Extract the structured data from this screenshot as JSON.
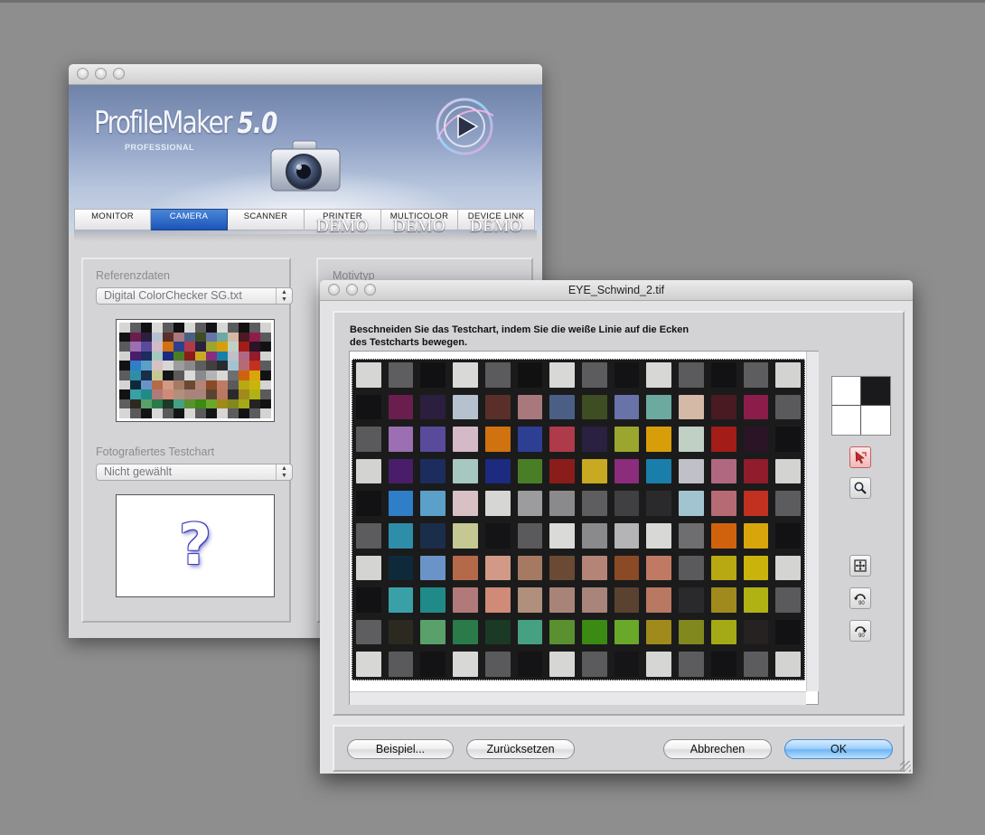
{
  "main_window": {
    "logo": {
      "name": "ProfileMaker",
      "version": "5.0",
      "subtitle": "PROFESSIONAL"
    },
    "tabs": [
      {
        "label": "MONITOR",
        "demo": "",
        "active": false
      },
      {
        "label": "CAMERA",
        "demo": "",
        "active": true
      },
      {
        "label": "SCANNER",
        "demo": "",
        "active": false
      },
      {
        "label": "PRINTER",
        "demo": "DEMO",
        "active": false
      },
      {
        "label": "MULTICOLOR",
        "demo": "DEMO",
        "active": false
      },
      {
        "label": "DEVICE LINK",
        "demo": "DEMO",
        "active": false
      }
    ],
    "reference": {
      "label": "Referenzdaten",
      "selected": "Digital ColorChecker SG.txt"
    },
    "photographed": {
      "label": "Fotografiertes Testchart",
      "selected": "Nicht gewählt",
      "placeholder_glyph": "?"
    },
    "motivtyp_label": "Motivtyp"
  },
  "crop_window": {
    "title": "EYE_Schwind_2.tif",
    "instruction": "Beschneiden Sie das Testchart, indem Sie die weiße Linie auf die Ecken des Testcharts bewegen.",
    "tools": [
      "crop-pointer-icon",
      "zoom-icon",
      "fit-icon",
      "rotate-left-90-icon",
      "rotate-right-90-icon"
    ],
    "rotate_label": "90",
    "buttons": {
      "example": "Beispiel...",
      "reset": "Zurücksetzen",
      "cancel": "Abbrechen",
      "ok": "OK"
    }
  },
  "colors": {
    "accent_tab": "#1b55b8",
    "default_button": "#6fb6f3"
  },
  "test_chart": {
    "rows": [
      [
        "#d6d6d4",
        "#5e5e60",
        "#111113",
        "#d9d9d7",
        "#5b5b5d",
        "#111112",
        "#d8d8d6",
        "#5c5c5e",
        "#131315",
        "#d7d7d5",
        "#5b5b5d",
        "#121214",
        "#5d5d5f",
        "#d3d3d1"
      ],
      [
        "#121214",
        "#6a1e4e",
        "#2c1e3e",
        "#b6c1cf",
        "#5a2f2a",
        "#a9787c",
        "#4b5f86",
        "#3e4d22",
        "#6873a8",
        "#6caaa0",
        "#d3b9a6",
        "#4a1a22",
        "#8c1d4a",
        "#5a5a5c"
      ],
      [
        "#5a5a5c",
        "#9b6fb2",
        "#5a4a9c",
        "#d4b9c6",
        "#d07210",
        "#2d3f92",
        "#ae3a4a",
        "#2a2040",
        "#9aa62e",
        "#d89e0a",
        "#c0d0c4",
        "#a31c18",
        "#2a1426",
        "#121214"
      ],
      [
        "#d3d3d1",
        "#4a1d6a",
        "#1c2c5c",
        "#a6c8c0",
        "#1c2a80",
        "#4a7e26",
        "#8a1c1a",
        "#c8aa22",
        "#8c2c7c",
        "#1a7eaa",
        "#c0c0c8",
        "#b06880",
        "#901c2c",
        "#d3d3d1"
      ],
      [
        "#121214",
        "#2f7ec8",
        "#5aa0c8",
        "#d8c0c4",
        "#d6d6d4",
        "#9c9c9e",
        "#8a8a8c",
        "#5e5e60",
        "#404042",
        "#2a2a2c",
        "#a2c4d0",
        "#b66a74",
        "#c23020",
        "#5c5c5e"
      ],
      [
        "#5c5c5e",
        "#2e8eaa",
        "#1a2e4a",
        "#c6c894",
        "#141416",
        "#5a5a5c",
        "#dadad8",
        "#8a8a8c",
        "#b4b4b6",
        "#d8d8d6",
        "#6e6e70",
        "#d0620e",
        "#d8a60a",
        "#121214"
      ],
      [
        "#d4d4d2",
        "#0e2a3a",
        "#6a94c8",
        "#b46a4a",
        "#d29a86",
        "#a67a62",
        "#6a4a34",
        "#b48476",
        "#8a4a26",
        "#c07a64",
        "#5a5a5c",
        "#b8a812",
        "#cab40c",
        "#d4d4d2"
      ],
      [
        "#121214",
        "#3aa0a8",
        "#208a88",
        "#b07a7a",
        "#d08a78",
        "#b0907c",
        "#a88478",
        "#a8847a",
        "#5a4230",
        "#b87862",
        "#2a2a2c",
        "#a08a1e",
        "#b0b214",
        "#5a5a5c"
      ],
      [
        "#5e5e60",
        "#2c2a20",
        "#5aa06a",
        "#2a7a4a",
        "#1a3a26",
        "#46a082",
        "#5a9030",
        "#3a8a14",
        "#6aa82a",
        "#a08a1c",
        "#80881e",
        "#a4aa16",
        "#262222",
        "#121214"
      ],
      [
        "#d7d7d5",
        "#5a5a5c",
        "#131315",
        "#d8d8d6",
        "#5a5a5c",
        "#141416",
        "#d6d6d4",
        "#5b5b5d",
        "#151517",
        "#d6d6d4",
        "#5c5c5e",
        "#131315",
        "#5c5c5e",
        "#d3d3d1"
      ]
    ]
  }
}
